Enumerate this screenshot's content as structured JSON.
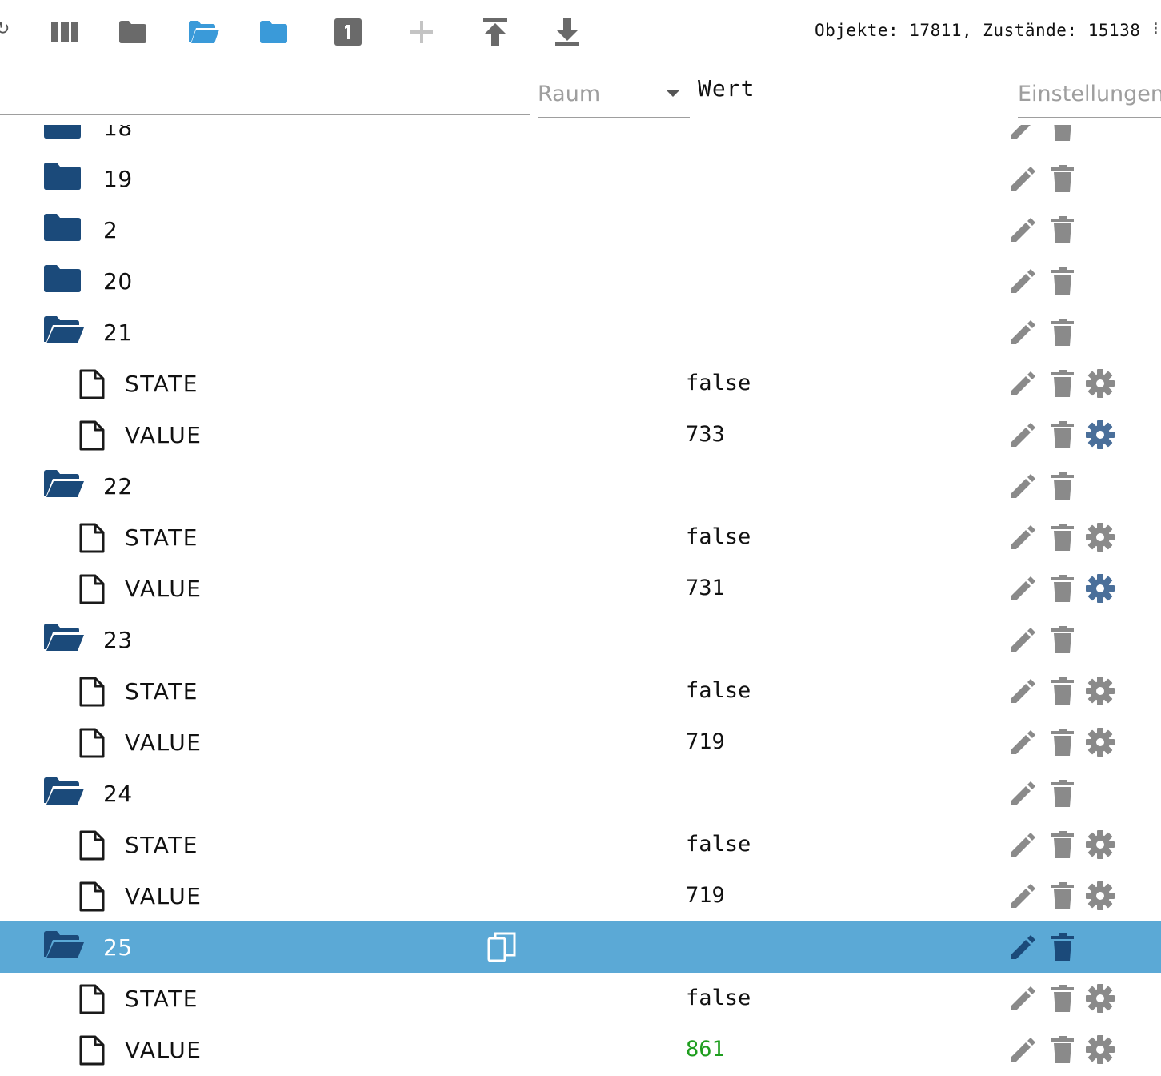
{
  "toolbar": {
    "buttons": [
      {
        "id": "columns",
        "icon": "view-columns-icon"
      },
      {
        "id": "collapse-all",
        "icon": "folder-icon"
      },
      {
        "id": "expand-one",
        "icon": "folder-open-icon"
      },
      {
        "id": "expand-all",
        "icon": "folder-blue-icon"
      },
      {
        "id": "show-level",
        "icon": "number-one-icon"
      },
      {
        "id": "add",
        "icon": "plus-icon"
      },
      {
        "id": "upload",
        "icon": "upload-icon"
      },
      {
        "id": "download",
        "icon": "download-icon"
      }
    ],
    "counts": "Objekte: 17811, Zustände: 15138"
  },
  "header": {
    "room_placeholder": "Raum",
    "value_label": "Wert",
    "settings_placeholder": "Einstellungen"
  },
  "colors": {
    "folder": "#1b4a7a",
    "accent": "#3a9ad9",
    "selected_row": "#5ba9d6",
    "icon_gray": "#8a8a8a",
    "gear_active": "#4a6f9a",
    "value_ack": "#1f9e1f"
  },
  "tree": {
    "rows": [
      {
        "type": "folder",
        "name": "18",
        "open": false
      },
      {
        "type": "folder",
        "name": "19",
        "open": false
      },
      {
        "type": "folder",
        "name": "2",
        "open": false
      },
      {
        "type": "folder",
        "name": "20",
        "open": false
      },
      {
        "type": "folder",
        "name": "21",
        "open": true
      },
      {
        "type": "state",
        "name": "STATE",
        "value": "false",
        "gear_active": false
      },
      {
        "type": "state",
        "name": "VALUE",
        "value": "733",
        "gear_active": true
      },
      {
        "type": "folder",
        "name": "22",
        "open": true
      },
      {
        "type": "state",
        "name": "STATE",
        "value": "false",
        "gear_active": false
      },
      {
        "type": "state",
        "name": "VALUE",
        "value": "731",
        "gear_active": true
      },
      {
        "type": "folder",
        "name": "23",
        "open": true
      },
      {
        "type": "state",
        "name": "STATE",
        "value": "false",
        "gear_active": false
      },
      {
        "type": "state",
        "name": "VALUE",
        "value": "719",
        "gear_active": false
      },
      {
        "type": "folder",
        "name": "24",
        "open": true
      },
      {
        "type": "state",
        "name": "STATE",
        "value": "false",
        "gear_active": false
      },
      {
        "type": "state",
        "name": "VALUE",
        "value": "719",
        "gear_active": false
      },
      {
        "type": "folder",
        "name": "25",
        "open": true,
        "selected": true
      },
      {
        "type": "state",
        "name": "STATE",
        "value": "false",
        "gear_active": false
      },
      {
        "type": "state",
        "name": "VALUE",
        "value": "861",
        "gear_active": false,
        "value_color": "green"
      }
    ]
  }
}
